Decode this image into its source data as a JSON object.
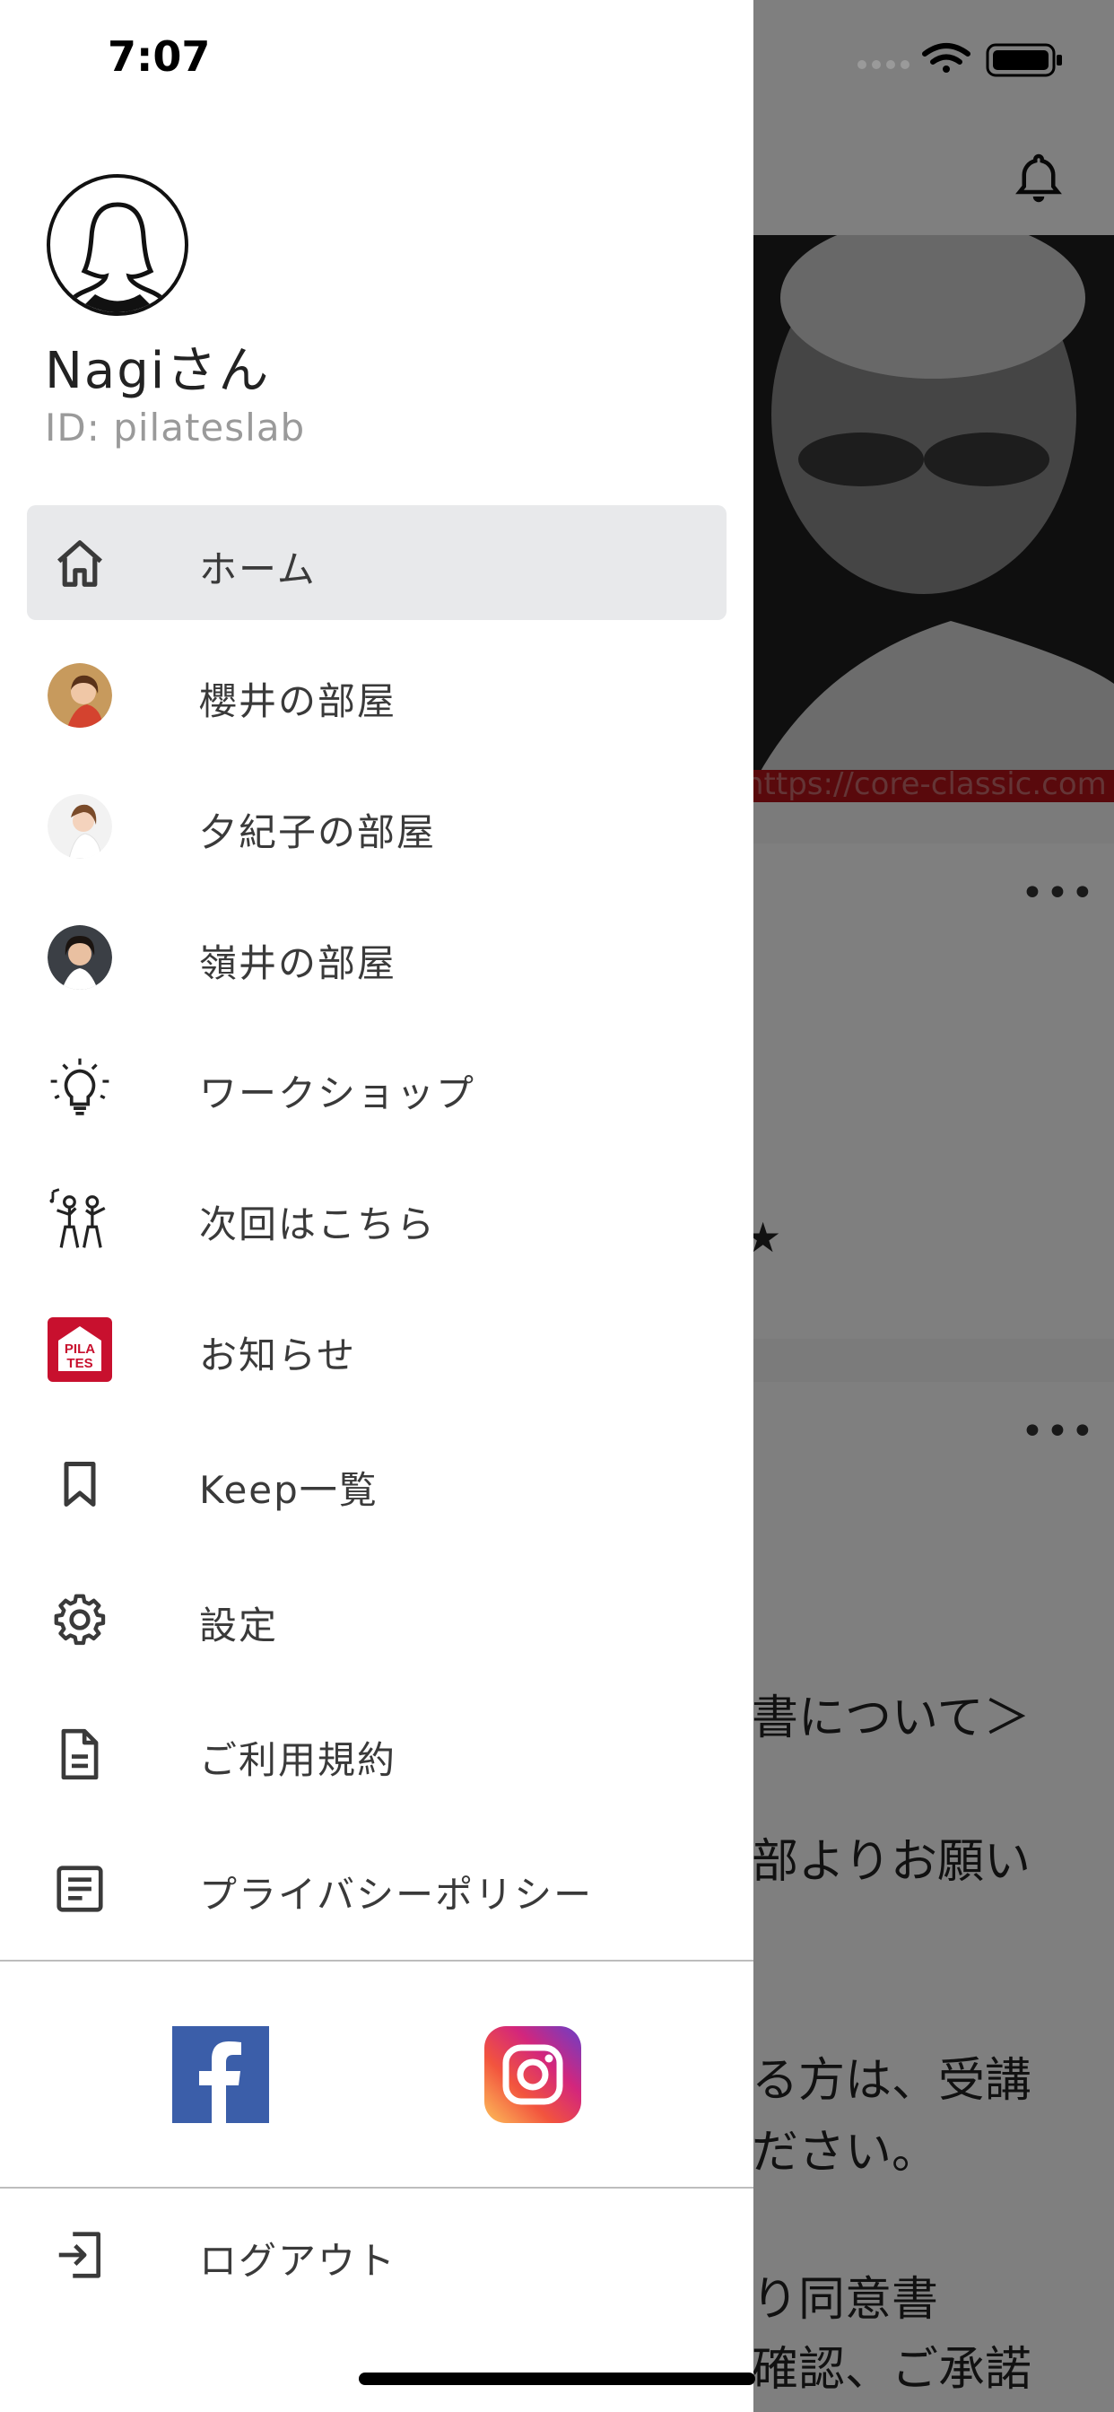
{
  "status_bar": {
    "time": "7:07"
  },
  "user": {
    "name": "Nagiさん",
    "id_text": "ID: pilateslab"
  },
  "menu": {
    "items": [
      {
        "label": "ホーム",
        "icon": "home-icon",
        "active": true
      },
      {
        "label": "櫻井の部屋",
        "icon": "room-avatar-sakurai"
      },
      {
        "label": "夕紀子の部屋",
        "icon": "room-avatar-yukiko"
      },
      {
        "label": "嶺井の部屋",
        "icon": "room-avatar-minei"
      },
      {
        "label": "ワークショップ",
        "icon": "lightbulb-icon"
      },
      {
        "label": "次回はこちら",
        "icon": "dancing-people-icon"
      },
      {
        "label": "お知らせ",
        "icon": "pilates-logo-icon"
      },
      {
        "label": "Keep一覧",
        "icon": "bookmark-icon"
      },
      {
        "label": "設定",
        "icon": "gear-icon"
      },
      {
        "label": "ご利用規約",
        "icon": "document-icon"
      },
      {
        "label": "プライバシーポリシー",
        "icon": "list-document-icon"
      }
    ]
  },
  "pilates_logo": {
    "line1": "PILA",
    "line2": "TES"
  },
  "social": {
    "facebook_icon": "facebook-icon",
    "instagram_icon": "instagram-icon"
  },
  "logout": {
    "label": "ログアウト",
    "icon": "logout-icon"
  },
  "background": {
    "photo_url_text": "https://core-classic.com",
    "text_lines": [
      "書について＞",
      "部よりお願い",
      "る方は、受講",
      "ださい。",
      "り同意書",
      "確認、ご承諾"
    ]
  },
  "colors": {
    "facebook": "#3b5ea9",
    "pilates_red": "#c8102e",
    "active_bg": "#e8e9eb"
  }
}
